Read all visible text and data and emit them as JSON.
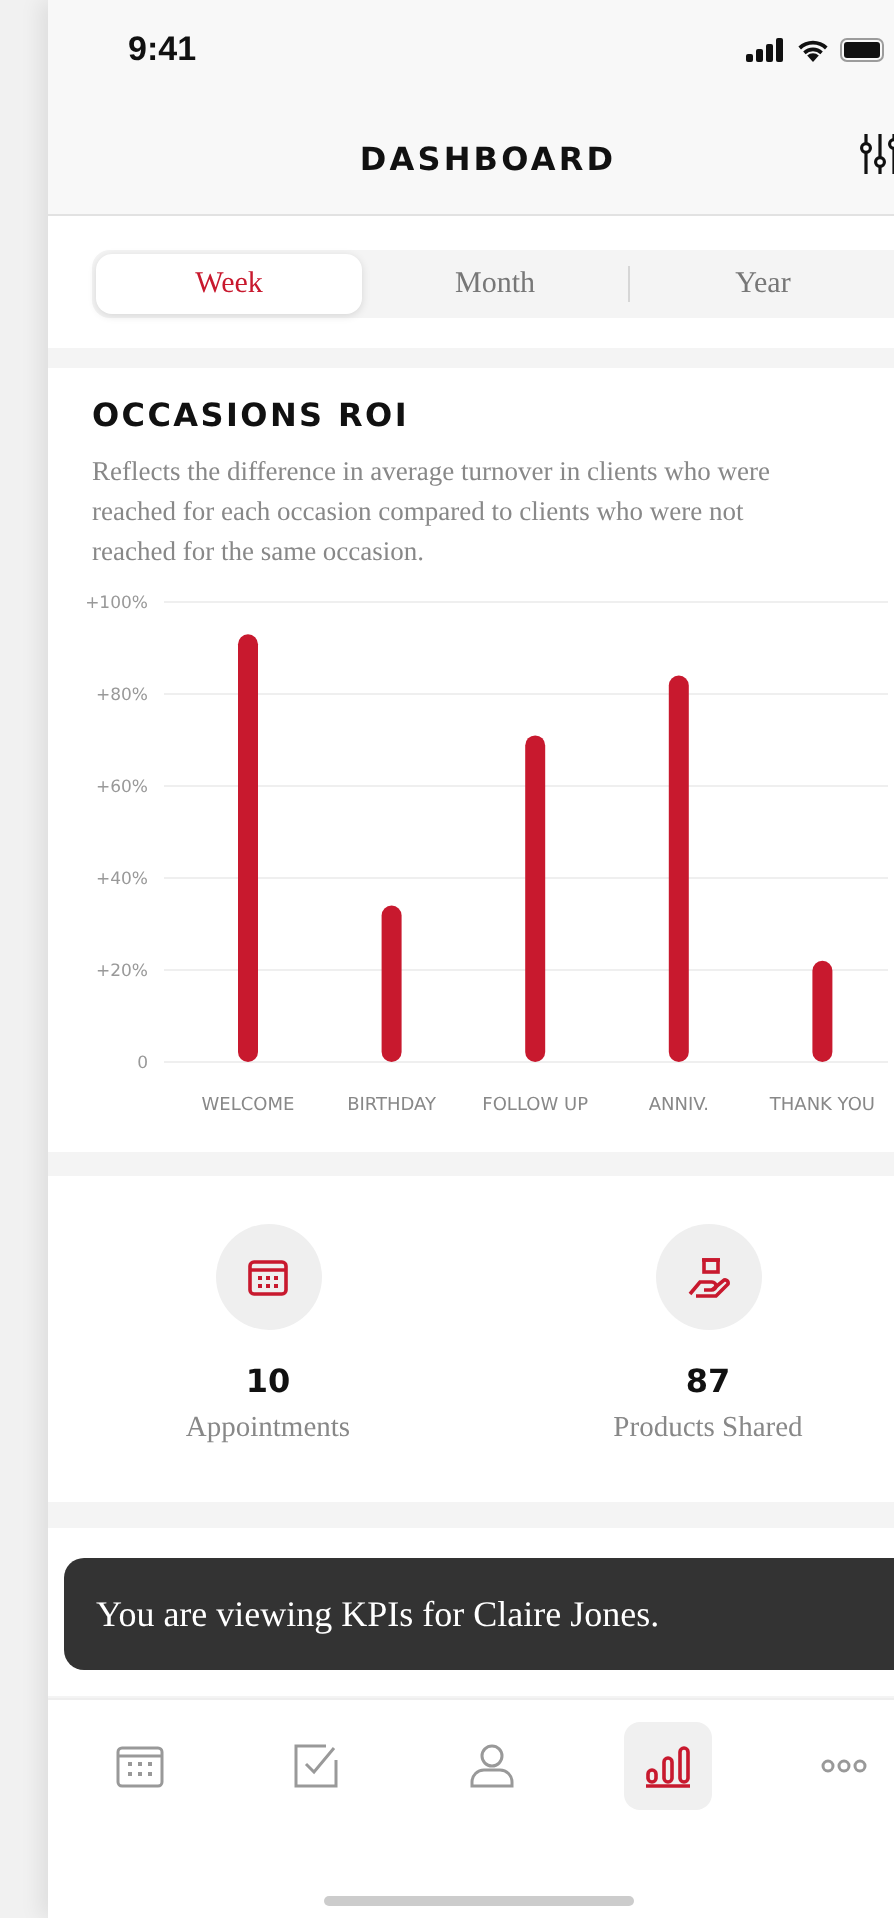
{
  "status_bar": {
    "time": "9:41"
  },
  "header": {
    "title": "DASHBOARD"
  },
  "period_tabs": [
    {
      "label": "Week",
      "selected": true
    },
    {
      "label": "Month",
      "selected": false
    },
    {
      "label": "Year",
      "selected": false
    }
  ],
  "occasions_roi": {
    "description": "Reflects the difference in average turnover in clients who were reached for each occasion compared to clients who were not reached for the same occasion.",
    "chart_data": {
      "type": "bar",
      "title": "OCCASIONS ROI",
      "categories": [
        "WELCOME",
        "BIRTHDAY",
        "FOLLOW UP",
        "ANNIV.",
        "THANK YOU"
      ],
      "series": [
        {
          "color": "#c8192e",
          "values": [
            93,
            34,
            71,
            84,
            22
          ]
        }
      ],
      "grid": true,
      "ylim": [
        0,
        100
      ],
      "yticks": [
        {
          "value": 0,
          "label": "0"
        },
        {
          "value": 20,
          "label": "+20%"
        },
        {
          "value": 40,
          "label": "+40%"
        },
        {
          "value": 60,
          "label": "+60%"
        },
        {
          "value": 80,
          "label": "+80%"
        },
        {
          "value": 100,
          "label": "+100%"
        }
      ]
    }
  },
  "stats": [
    {
      "value": "10",
      "label": "Appointments"
    },
    {
      "value": "87",
      "label": "Products Shared"
    }
  ],
  "toast": {
    "text": "You are viewing KPIs for Claire Jones."
  },
  "tab_bar": [
    {
      "selected": false
    },
    {
      "selected": false
    },
    {
      "selected": false
    },
    {
      "selected": true
    },
    {
      "selected": false
    }
  ]
}
